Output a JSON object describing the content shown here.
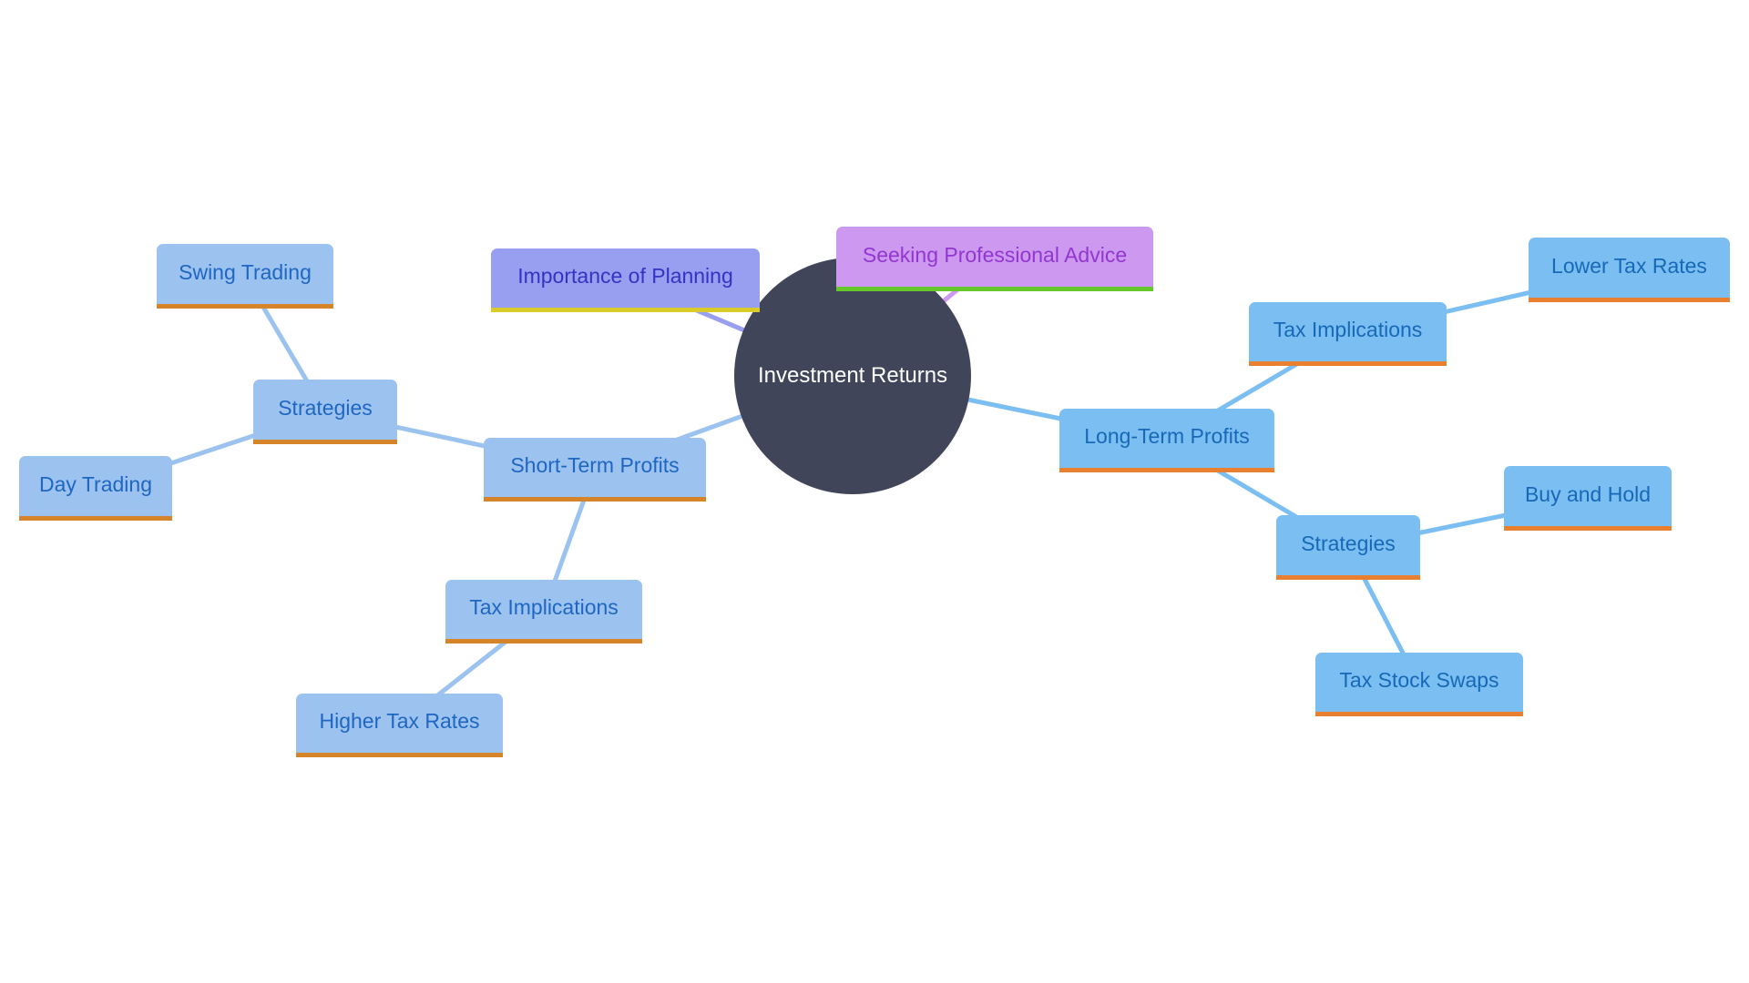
{
  "diagram": {
    "type": "mindmap",
    "root": {
      "id": "root",
      "label": "Investment Returns",
      "color": "#41455a"
    },
    "nodes": [
      {
        "id": "planning",
        "label": "Importance of Planning",
        "parent": "root",
        "style": "plan"
      },
      {
        "id": "advice",
        "label": "Seeking Professional Advice",
        "parent": "root",
        "style": "advice"
      },
      {
        "id": "short",
        "label": "Short-Term Profits",
        "parent": "root",
        "style": "left"
      },
      {
        "id": "short-strat",
        "label": "Strategies",
        "parent": "short",
        "style": "left"
      },
      {
        "id": "swing",
        "label": "Swing Trading",
        "parent": "short-strat",
        "style": "left"
      },
      {
        "id": "day",
        "label": "Day Trading",
        "parent": "short-strat",
        "style": "left"
      },
      {
        "id": "short-tax",
        "label": "Tax Implications",
        "parent": "short",
        "style": "left"
      },
      {
        "id": "higher",
        "label": "Higher Tax Rates",
        "parent": "short-tax",
        "style": "left"
      },
      {
        "id": "long",
        "label": "Long-Term Profits",
        "parent": "root",
        "style": "right"
      },
      {
        "id": "long-tax",
        "label": "Tax Implications",
        "parent": "long",
        "style": "right"
      },
      {
        "id": "lower",
        "label": "Lower Tax Rates",
        "parent": "long-tax",
        "style": "right"
      },
      {
        "id": "long-strat",
        "label": "Strategies",
        "parent": "long",
        "style": "right"
      },
      {
        "id": "buy",
        "label": "Buy and Hold",
        "parent": "long-strat",
        "style": "right"
      },
      {
        "id": "swaps",
        "label": "Tax Stock Swaps",
        "parent": "long-strat",
        "style": "right"
      }
    ],
    "colors": {
      "left_fill": "#9cc3ef",
      "left_accent": "#d5842a",
      "right_fill": "#7bbef1",
      "right_accent": "#e8802f",
      "planning_fill": "#989ef0",
      "planning_accent": "#d9cc2a",
      "advice_fill": "#cc98f0",
      "advice_accent": "#66c72a"
    }
  }
}
